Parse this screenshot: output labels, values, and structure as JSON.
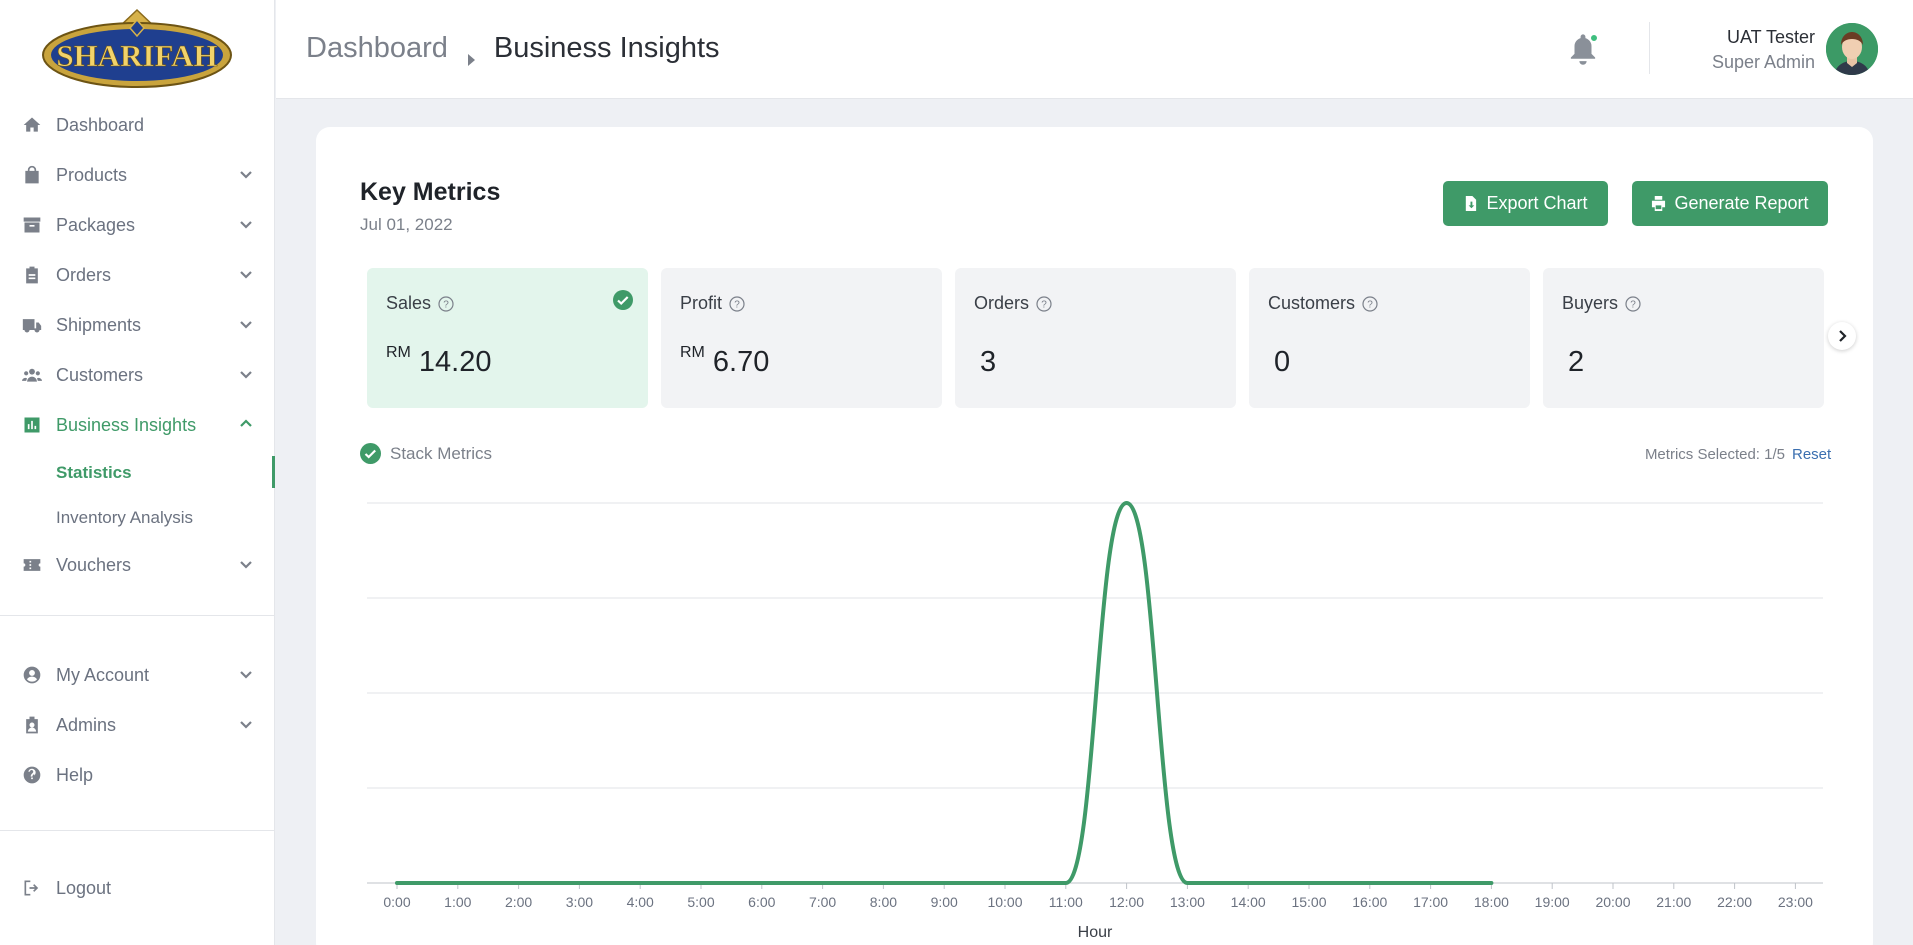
{
  "sidebar": {
    "logo_text": "SHARIFAH",
    "items": [
      {
        "label": "Dashboard",
        "icon": "home-icon"
      },
      {
        "label": "Products",
        "icon": "shopping-bag-icon"
      },
      {
        "label": "Packages",
        "icon": "archive-box-icon"
      },
      {
        "label": "Orders",
        "icon": "clipboard-icon"
      },
      {
        "label": "Shipments",
        "icon": "truck-icon"
      },
      {
        "label": "Customers",
        "icon": "users-icon"
      },
      {
        "label": "Business Insights",
        "icon": "bar-chart-icon"
      }
    ],
    "subitems": [
      {
        "label": "Statistics"
      },
      {
        "label": "Inventory Analysis"
      }
    ],
    "vouchers": {
      "label": "Vouchers",
      "icon": "ticket-icon"
    },
    "bottom": [
      {
        "label": "My Account",
        "icon": "user-circle-icon"
      },
      {
        "label": "Admins",
        "icon": "id-badge-icon"
      },
      {
        "label": "Help",
        "icon": "question-circle-icon"
      }
    ],
    "logout": {
      "label": "Logout",
      "icon": "logout-icon"
    }
  },
  "header": {
    "breadcrumb_parent": "Dashboard",
    "breadcrumb_current": "Business Insights",
    "user_name": "UAT Tester",
    "user_role": "Super Admin"
  },
  "card": {
    "title": "Key Metrics",
    "date": "Jul 01, 2022",
    "export_label": "Export Chart",
    "report_label": "Generate Report",
    "metrics": [
      {
        "label": "Sales",
        "currency": "RM",
        "value": "14.20",
        "selected": true
      },
      {
        "label": "Profit",
        "currency": "RM",
        "value": "6.70",
        "selected": false
      },
      {
        "label": "Orders",
        "currency": "",
        "value": "3",
        "selected": false
      },
      {
        "label": "Customers",
        "currency": "",
        "value": "0",
        "selected": false
      },
      {
        "label": "Buyers",
        "currency": "",
        "value": "2",
        "selected": false
      }
    ],
    "stack_label": "Stack Metrics",
    "metrics_selected": "Metrics Selected: 1/5",
    "reset_label": "Reset"
  },
  "colors": {
    "accent": "#3f9a68",
    "selected_card": "#e3f5ec",
    "link": "#3b6fb0"
  },
  "chart_data": {
    "type": "line",
    "xlabel": "Hour",
    "categories": [
      "0:00",
      "1:00",
      "2:00",
      "3:00",
      "4:00",
      "5:00",
      "6:00",
      "7:00",
      "8:00",
      "9:00",
      "10:00",
      "11:00",
      "12:00",
      "13:00",
      "14:00",
      "15:00",
      "16:00",
      "17:00",
      "18:00",
      "19:00",
      "20:00",
      "21:00",
      "22:00",
      "23:00"
    ],
    "series": [
      {
        "values": [
          0,
          0,
          0,
          0,
          0,
          0,
          0,
          0,
          0,
          0,
          0,
          0,
          14.2,
          0,
          0,
          0,
          0,
          0,
          0
        ]
      }
    ],
    "ylim": [
      0,
      14.2
    ],
    "grid": true,
    "smooth": true
  }
}
